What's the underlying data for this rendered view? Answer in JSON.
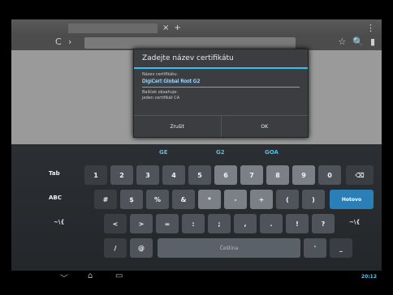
{
  "browser": {
    "tab_close_glyph": "×",
    "tab_new_glyph": "+",
    "menu_glyph": "⋮",
    "nav_glyphs": [
      "C",
      "›"
    ],
    "toolbar_icons": [
      "☆",
      "🔍",
      "▮"
    ]
  },
  "dialog": {
    "title": "Zadejte název certifikátu",
    "name_label": "Název certifikátu:",
    "name_value": "DigiCert Global Root G2",
    "package_label": "Balíček obsahuje:",
    "package_value": "jeden certifikát CA",
    "cancel_label": "Zrušit",
    "ok_label": "OK"
  },
  "keyboard": {
    "suggestions": [
      "GE",
      "G2",
      "GOA"
    ],
    "row1_left": "Tab",
    "row1": [
      "1",
      "2",
      "3",
      "4",
      "5",
      "6",
      "7",
      "8",
      "9",
      "0"
    ],
    "row1_right": "⌫",
    "row2_left": "ABC",
    "row2": [
      "#",
      "$",
      "%",
      "&",
      "*",
      "-",
      "+",
      "(",
      ")"
    ],
    "row2_right": "Hotovo",
    "row3_left": "~\\{",
    "row3": [
      "<",
      ">",
      "=",
      ":",
      ";",
      ",",
      ".",
      "!",
      "?"
    ],
    "row3_right": "~\\{",
    "row4": [
      "/",
      "@"
    ],
    "space_label": "Čeština",
    "row4_right": [
      "'",
      "_"
    ]
  },
  "system_bar": {
    "back": "﹀",
    "home": "⌂",
    "recents": "▭",
    "clock": "20:12"
  },
  "colors": {
    "accent": "#2ec3f0",
    "done_key": "#2b7fb7"
  }
}
